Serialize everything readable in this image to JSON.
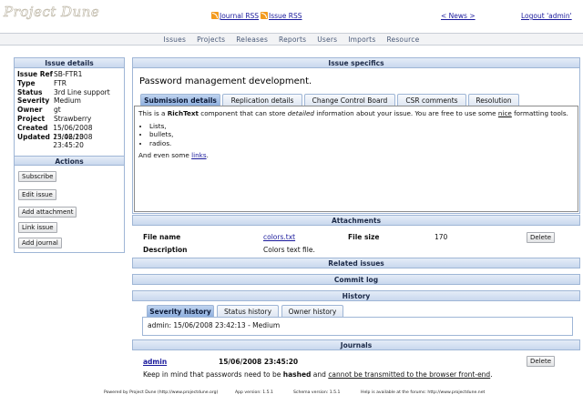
{
  "header": {
    "logo": "Project Dune",
    "journal_rss": "Journal RSS",
    "issue_rss": "Issue RSS",
    "news": "< News >",
    "logout": "Logout 'admin'"
  },
  "nav": [
    "Issues",
    "Projects",
    "Releases",
    "Reports",
    "Users",
    "Imports",
    "Resource"
  ],
  "issue_details": {
    "title": "Issue details",
    "rows": [
      {
        "k": "Issue Ref",
        "v": "SB-FTR1"
      },
      {
        "k": "Type",
        "v": "FTR"
      },
      {
        "k": "Status",
        "v": "3rd Line support"
      },
      {
        "k": "Severity",
        "v": "Medium"
      },
      {
        "k": "Owner",
        "v": "gt"
      },
      {
        "k": "Project",
        "v": "Strawberry"
      },
      {
        "k": "Created",
        "v": "15/06/2008 23:42:13"
      },
      {
        "k": "Updated",
        "v": "15/06/2008 23:45:20"
      }
    ]
  },
  "actions": {
    "title": "Actions",
    "subscribe": "Subscribe",
    "edit": "Edit issue",
    "add_attachment": "Add attachment",
    "link": "Link issue",
    "add_journal": "Add journal"
  },
  "specifics": {
    "title": "Issue specifics",
    "headline": "Password management development.",
    "tabs": [
      "Submission details",
      "Replication details",
      "Change Control Board",
      "CSR comments",
      "Resolution"
    ],
    "rich": {
      "p1_a": "This is a ",
      "p1_b": "RichText",
      "p1_c": " component that can store ",
      "p1_d": "detailed",
      "p1_e": " information about your issue. You are free to use some ",
      "p1_f": "nice",
      "p1_g": " formatting tools.",
      "items": [
        "Lists,",
        "bullets,",
        "radios."
      ],
      "p2_a": "And even some ",
      "p2_b": "links",
      "p2_c": "."
    }
  },
  "attachments": {
    "title": "Attachments",
    "file_name_label": "File name",
    "file_name": "colors.txt",
    "file_size_label": "File size",
    "file_size": "170",
    "delete": "Delete",
    "description_label": "Description",
    "description": "Colors text file."
  },
  "related_title": "Related issues",
  "commit_title": "Commit log",
  "history": {
    "title": "History",
    "tabs": [
      "Severity history",
      "Status history",
      "Owner history"
    ],
    "entry": "admin: 15/06/2008 23:42:13 - Medium"
  },
  "journals": {
    "title": "Journals",
    "author": "admin",
    "date": "15/06/2008 23:45:20",
    "delete": "Delete",
    "t1": "Keep in mind that passwords need to be ",
    "t2": "hashed",
    "t3": " and ",
    "t4": "cannot be transmitted to the browser front-end",
    "t5": "."
  },
  "footer": {
    "powered": "Powered by Project Dune (http://www.projectdune.org)",
    "app_version": "App version: 1.5.1",
    "schema_version": "Schema version: 1.5.1",
    "help": "Help is available at the forums: http://www.projectdune.net"
  }
}
